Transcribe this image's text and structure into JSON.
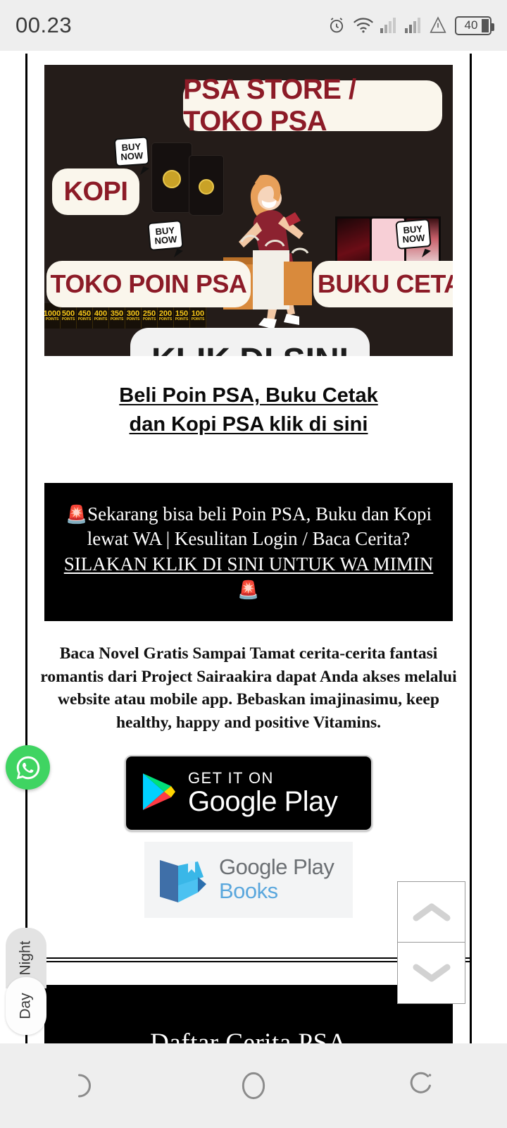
{
  "statusbar": {
    "time": "00.23",
    "battery_level": "40",
    "icons": [
      "alarm-icon",
      "wifi-icon",
      "signal-sim1-icon",
      "signal-sim2-icon",
      "warning-triangle-icon",
      "battery-icon"
    ]
  },
  "banner": {
    "alt": "PSA Store promotional banner",
    "labels": {
      "store": "PSA STORE / TOKO PSA",
      "kopi": "KOPI",
      "toko_poin": "TOKO POIN PSA",
      "buku_cetak": "BUKU CETAK",
      "klik": "KLIK DI SINI"
    },
    "buy_now": "BUY NOW",
    "buy_now_line1": "BUY",
    "buy_now_line2": "NOW",
    "points_label": "POINTS",
    "points": [
      "1000",
      "500",
      "450",
      "400",
      "350",
      "300",
      "250",
      "200",
      "150",
      "100"
    ]
  },
  "link_heading": {
    "line1": "Beli Poin PSA, Buku Cetak",
    "line2": "dan Kopi PSA klik di sini"
  },
  "announcement": {
    "siren_start": "🚨",
    "text_before": "Sekarang bisa beli Poin PSA, Buku dan Kopi lewat WA | Kesulitan Login / Baca Cerita? ",
    "link_text": "SILAKAN KLIK DI SINI UNTUK WA MIMIN",
    "siren_end": "🚨"
  },
  "blurb": "Baca Novel Gratis Sampai Tamat cerita-cerita fantasi romantis dari Project Sairaakira dapat Anda akses melalui website atau mobile app. Bebaskan imajinasimu, keep healthy, happy and positive Vitamins.",
  "google_play": {
    "get_it_on": "GET IT ON",
    "name": "Google Play"
  },
  "google_play_books": {
    "line1": "Google Play",
    "line2": "Books"
  },
  "bottom_section": {
    "title": "Daftar Cerita PSA"
  },
  "floating": {
    "whatsapp_label": "WhatsApp",
    "night": "Night",
    "day": "Day"
  },
  "scroll": {
    "up": "scroll-up",
    "down": "scroll-down"
  },
  "navbar": {
    "back": "back",
    "home": "home",
    "recents": "recents"
  },
  "colors": {
    "banner_bg": "#241c19",
    "banner_accent": "#8c1b27",
    "pill_bg": "#faf6ec",
    "whatsapp_green": "#3fd462",
    "points_gold": "#f5c518"
  }
}
